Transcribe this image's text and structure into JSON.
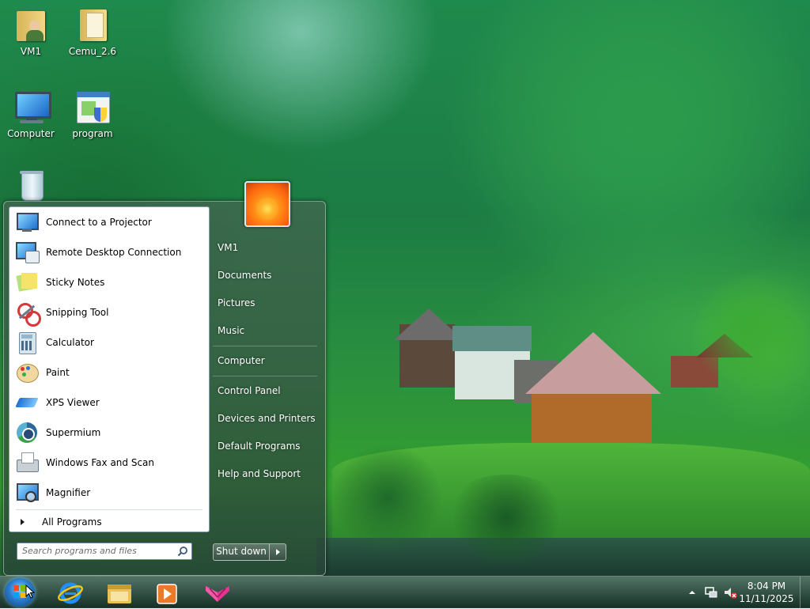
{
  "desktop": {
    "icons": [
      {
        "label": "VM1",
        "icon": "folder-user-icon"
      },
      {
        "label": "Cemu_2.6",
        "icon": "folder-icon"
      },
      {
        "label": "Computer",
        "icon": "computer-icon"
      },
      {
        "label": "program",
        "icon": "program-shortcut-icon"
      },
      {
        "label": "",
        "icon": "recycle-bin-icon"
      }
    ]
  },
  "start_menu": {
    "programs": [
      {
        "label": "Connect to a Projector",
        "icon": "projector-icon"
      },
      {
        "label": "Remote Desktop Connection",
        "icon": "remote-desktop-icon"
      },
      {
        "label": "Sticky Notes",
        "icon": "sticky-notes-icon"
      },
      {
        "label": "Snipping Tool",
        "icon": "snipping-tool-icon"
      },
      {
        "label": "Calculator",
        "icon": "calculator-icon"
      },
      {
        "label": "Paint",
        "icon": "paint-icon"
      },
      {
        "label": "XPS Viewer",
        "icon": "xps-viewer-icon"
      },
      {
        "label": "Supermium",
        "icon": "supermium-icon"
      },
      {
        "label": "Windows Fax and Scan",
        "icon": "fax-scan-icon"
      },
      {
        "label": "Magnifier",
        "icon": "magnifier-icon"
      }
    ],
    "all_programs_label": "All Programs",
    "search_placeholder": "Search programs and files",
    "right_items": [
      {
        "label": "VM1"
      },
      {
        "label": "Documents"
      },
      {
        "label": "Pictures"
      },
      {
        "label": "Music"
      },
      {
        "label": "Computer"
      },
      {
        "label": "Control Panel"
      },
      {
        "label": "Devices and Printers"
      },
      {
        "label": "Default Programs"
      },
      {
        "label": "Help and Support"
      }
    ],
    "shutdown_label": "Shut down"
  },
  "taskbar": {
    "pinned": [
      {
        "icon": "internet-explorer-icon"
      },
      {
        "icon": "file-explorer-icon"
      },
      {
        "icon": "media-player-icon"
      },
      {
        "icon": "pink-cube-app-icon"
      }
    ],
    "clock": {
      "time": "8:04 PM",
      "date": "11/11/2025"
    }
  },
  "colors": {
    "accent": "#2a7fd0",
    "menu_glass": "#3c5a4a",
    "text_light": "#ffffff"
  }
}
